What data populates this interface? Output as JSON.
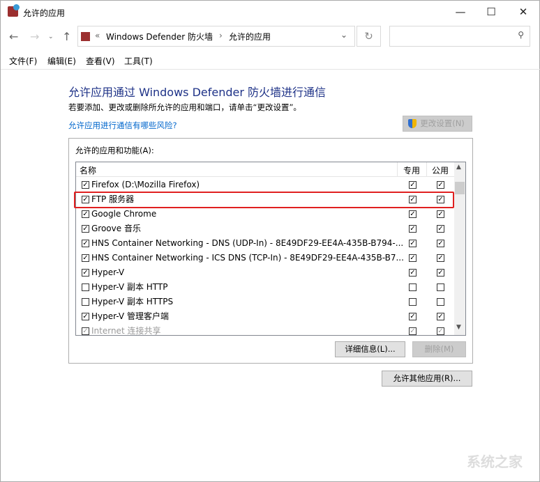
{
  "window": {
    "title": "允许的应用",
    "minimize": "—",
    "maximize": "☐",
    "close": "✕"
  },
  "address": {
    "prefix": "«",
    "crumbs": [
      "Windows Defender 防火墙",
      "允许的应用"
    ],
    "search_placeholder": ""
  },
  "menu": [
    "文件(F)",
    "编辑(E)",
    "查看(V)",
    "工具(T)"
  ],
  "main": {
    "heading": "允许应用通过 Windows Defender 防火墙进行通信",
    "description": "若要添加、更改或删除所允许的应用和端口，请单击“更改设置”。",
    "risk_link": "允许应用进行通信有哪些风险?",
    "change_settings": "更改设置(N)",
    "list_label": "允许的应用和功能(A):",
    "columns": {
      "name": "名称",
      "private": "专用",
      "public": "公用"
    },
    "rows": [
      {
        "name": "Firefox (D:\\Mozilla Firefox)",
        "enabled": true,
        "private": true,
        "public": true
      },
      {
        "name": "FTP 服务器",
        "enabled": true,
        "private": true,
        "public": true,
        "highlighted": true
      },
      {
        "name": "Google Chrome",
        "enabled": true,
        "private": true,
        "public": true
      },
      {
        "name": "Groove 音乐",
        "enabled": true,
        "private": true,
        "public": true
      },
      {
        "name": "HNS Container Networking - DNS (UDP-In) - 8E49DF29-EE4A-435B-B794-...",
        "enabled": true,
        "private": true,
        "public": true
      },
      {
        "name": "HNS Container Networking - ICS DNS (TCP-In) - 8E49DF29-EE4A-435B-B7...",
        "enabled": true,
        "private": true,
        "public": true
      },
      {
        "name": "Hyper-V",
        "enabled": true,
        "private": true,
        "public": true
      },
      {
        "name": "Hyper-V 副本 HTTP",
        "enabled": false,
        "private": false,
        "public": false
      },
      {
        "name": "Hyper-V 副本 HTTPS",
        "enabled": false,
        "private": false,
        "public": false
      },
      {
        "name": "Hyper-V 管理客户端",
        "enabled": true,
        "private": true,
        "public": true
      },
      {
        "name": "Internet 连接共享",
        "enabled": true,
        "private": true,
        "public": true
      }
    ],
    "details_button": "详细信息(L)...",
    "remove_button": "删除(M)",
    "allow_other_button": "允许其他应用(R)..."
  },
  "watermark": "系统之家",
  "colors": {
    "heading": "#1e3287",
    "link": "#0066cc",
    "highlight": "#e02020"
  }
}
